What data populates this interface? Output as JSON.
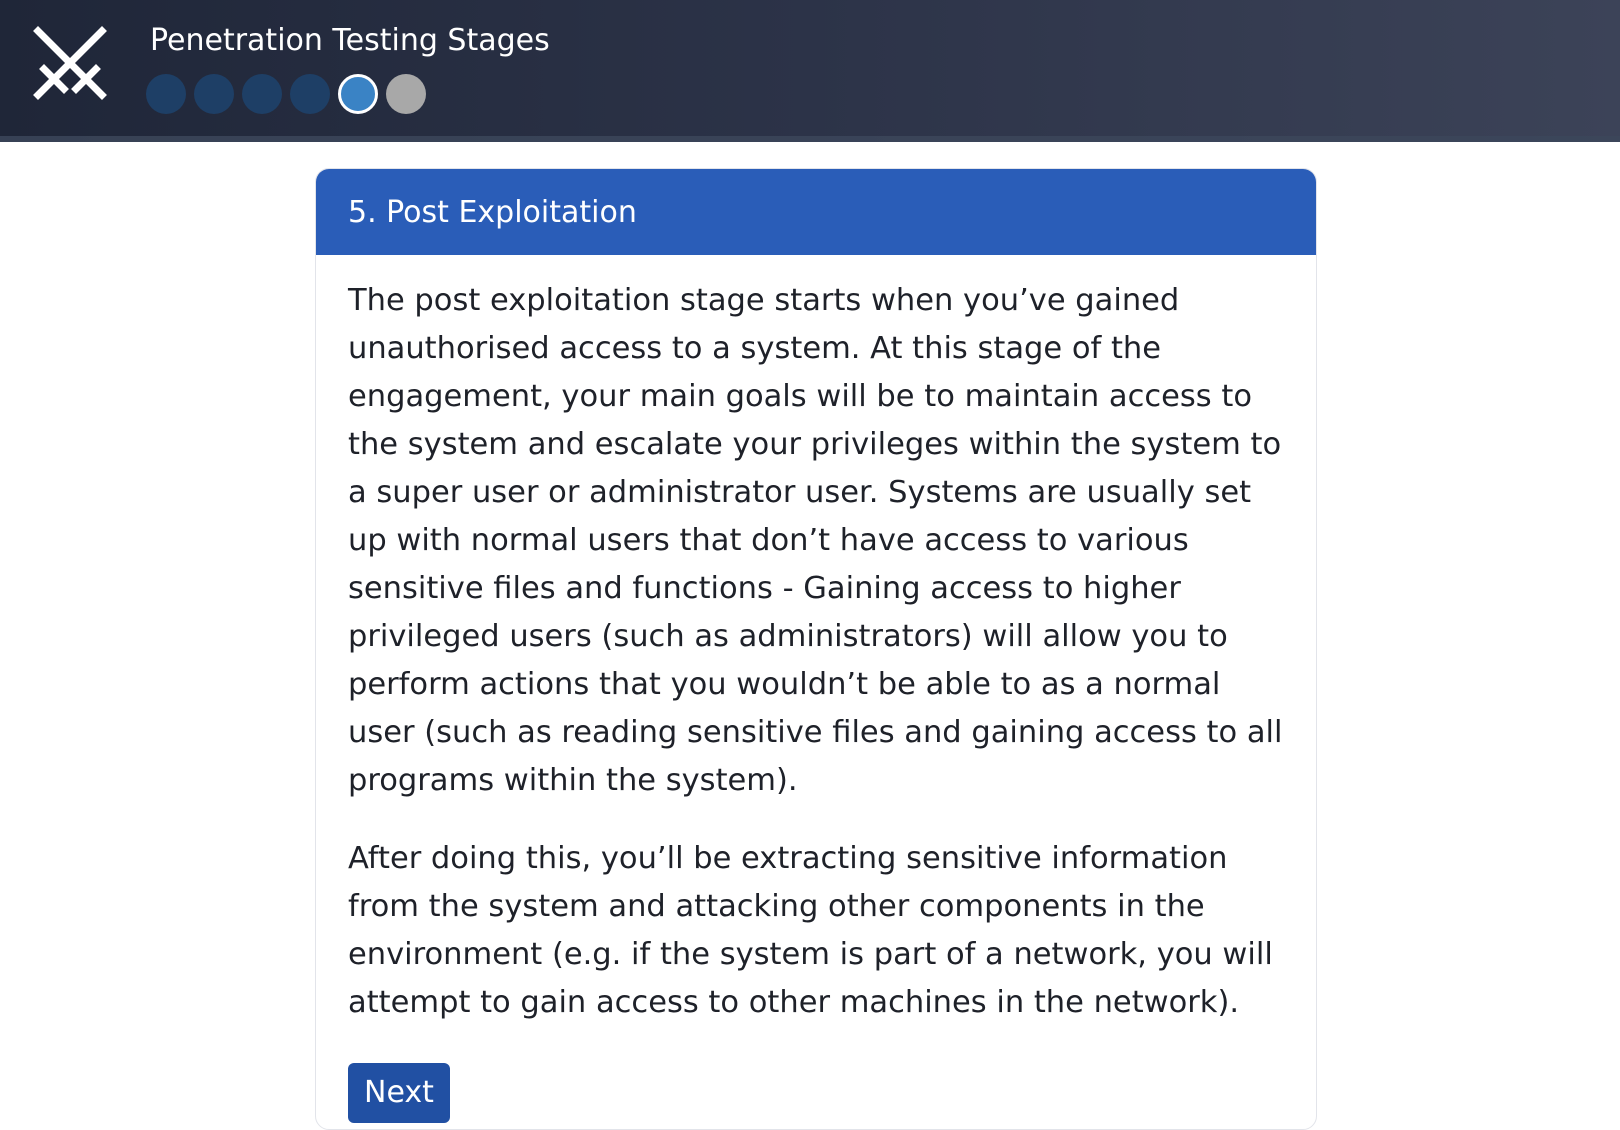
{
  "header": {
    "title": "Penetration Testing Stages",
    "logo_icon": "crossed-swords-icon",
    "steps": [
      {
        "state": "completed",
        "color": "#1e3f66"
      },
      {
        "state": "completed",
        "color": "#1e3f66"
      },
      {
        "state": "completed",
        "color": "#1e3f66"
      },
      {
        "state": "completed",
        "color": "#1e3f66"
      },
      {
        "state": "current",
        "color": "#3a83c5"
      },
      {
        "state": "upcoming",
        "color": "#a8a8a8"
      }
    ]
  },
  "card": {
    "title": "5. Post Exploitation",
    "header_color": "#2a5db8",
    "paragraphs": [
      "The post exploitation stage starts when you’ve gained unauthorised access to a system. At this stage of the engagement, your main goals will be to maintain access to the system and escalate your privileges within the system to a super user or administrator user. Systems are usually set up with normal users that don’t have access to various sensitive files and functions - Gaining access to higher privileged users (such as administrators) will allow you to perform actions that you wouldn’t be able to as a normal user (such as reading sensitive files and gaining access to all programs within the system).",
      "After doing this, you’ll be extracting sensitive information from the system and attacking other components in the environment (e.g. if the system is part of a network, you will attempt to gain access to other machines in the network)."
    ],
    "next_label": "Next",
    "button_color": "#2150a3"
  }
}
